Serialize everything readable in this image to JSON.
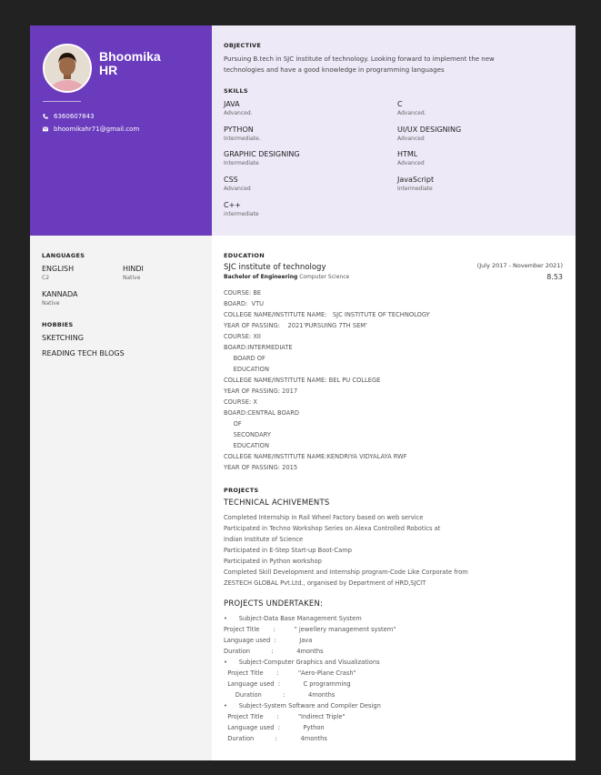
{
  "profile": {
    "first_name": "Bhoomika",
    "last_name": "HR",
    "phone": "6360607843",
    "email": "bhoomikahr71@gmail.com"
  },
  "objective": {
    "title": "OBJECTIVE",
    "line1": " Pursuing B.tech in SJC institute of technology. Looking forward to implement the new",
    "line2": "technologies and have a good knowledge in programming languages"
  },
  "skills": {
    "title": "SKILLS",
    "items": [
      {
        "name": "JAVA",
        "level": "Advanced."
      },
      {
        "name": "C",
        "level": "Advanced."
      },
      {
        "name": "PYTHON",
        "level": "Intermediate."
      },
      {
        "name": "UI/UX DESIGNING",
        "level": "Advanced"
      },
      {
        "name": "GRAPHIC DESIGNING",
        "level": "Intermediate"
      },
      {
        "name": "HTML",
        "level": "Advanced"
      },
      {
        "name": "CSS",
        "level": "Advanced"
      },
      {
        "name": "JavaScript",
        "level": "Intermediate"
      },
      {
        "name": "C++",
        "level": "intermediate"
      }
    ]
  },
  "languages": {
    "title": "LANGUAGES",
    "items": [
      {
        "name": "ENGLISH",
        "level": "C2"
      },
      {
        "name": "HINDI",
        "level": "Native"
      },
      {
        "name": "KANNADA",
        "level": "Native"
      }
    ]
  },
  "hobbies": {
    "title": "HOBBIES",
    "items": [
      "SKETCHING",
      "READING TECH BLOGS"
    ]
  },
  "education": {
    "title": "EDUCATION",
    "school": "SJC institute of technology",
    "degree": "Bachelor of Engineering",
    "field": " Computer Science",
    "dates": "(July 2017 - November 2021)",
    "score": "8.53",
    "details": [
      "COURSE: BE",
      "BOARD:  VTU",
      "COLLEGE NAME/INSTITUTE NAME:   SJC INSTITUTE OF TECHNOLOGY",
      "YEAR OF PASSING:    2021'PURSUING 7TH SEM'",
      "COURSE: XII",
      "BOARD:INTERMEDIATE",
      "     BOARD OF",
      "     EDUCATION",
      "COLLEGE NAME/INSTITUTE NAME: BEL PU COLLEGE",
      "YEAR OF PASSING: 2017",
      "COURSE: X",
      "BOARD:CENTRAL BOARD",
      "     OF",
      "     SECONDARY",
      "     EDUCATION",
      "COLLEGE NAME/INSTITUTE NAME:KENDRIYA VIDYALAYA RWF",
      "YEAR OF PASSING: 2015"
    ]
  },
  "projects": {
    "title": "PROJECTS",
    "achievements_title": "TECHNICAL ACHIVEMENTS",
    "achievements": [
      "Completed Internship in Rail Wheel Factory based on web service",
      "Participated in Techno Workshop Series on Alexa Controlled Robotics at",
      "Indian Institute of Science",
      "Participated in E-Step Start-up Boot-Camp",
      "Participated in Python workshop",
      "Completed Skill Development and Internship program-Code Like Corporate from",
      "ZESTECH GLOBAL Pvt.Ltd., organised by Department of HRD,SJCIT"
    ],
    "undertaken_title": "PROJECTS UNDERTAKEN:",
    "undertaken": [
      "•      Subject-Data Base Management System",
      "Project Title       :          \" jewellery management system\"",
      "Language used  :            Java",
      "Duration           :            4months",
      "•      Subject-Computer Graphics and Visualizations",
      "  Project Title       :          \"Aero-Plane Crash\"",
      "  Language used  :            C programming",
      "      Duration           :            4months",
      "•      Subject-System Software and Compiler Design",
      "  Project Title       :          \"Indirect Triple\"",
      "  Language used  :            Python",
      "  Duration           :            4months"
    ]
  }
}
